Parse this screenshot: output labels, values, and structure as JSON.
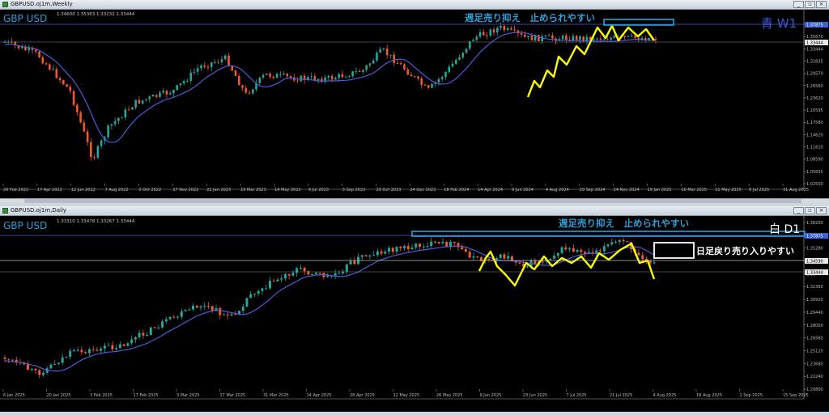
{
  "windows": {
    "weekly": {
      "title": "GBPUSD.oj1m,Weekly",
      "symbol_label": "GBP USD",
      "ohlc": "1.34600 1.35363 1.33232 1.33444",
      "note": "週足売り抑え　止められやすい",
      "tf_label": "青 W1",
      "price_ticks": [
        "1.37875",
        "1.35670",
        "1.33444",
        "1.32835",
        "1.29570",
        "1.26560",
        "1.23620",
        "1.20595",
        "1.17580",
        "1.14620",
        "1.11610",
        "1.08590",
        "1.05655",
        "1.02550"
      ],
      "date_ticks": [
        "20 Feb 2022",
        "17 Apr 2022",
        "12 Jun 2022",
        "7 Aug 2022",
        "2 Oct 2022",
        "27 Nov 2022",
        "22 Jan 2023",
        "19 Mar 2023",
        "14 May 2023",
        "9 Jul 2023",
        "3 Sep 2023",
        "29 Oct 2023",
        "24 Dec 2023",
        "18 Feb 2024",
        "14 Apr 2024",
        "9 Jun 2024",
        "4 Aug 2024",
        "29 Sep 2024",
        "24 Nov 2024",
        "19 Jan 2025",
        "16 Mar 2025",
        "11 May 2025",
        "6 Jul 2025",
        "31 Aug 2025"
      ]
    },
    "daily": {
      "title": "GBPUSD.oj1m,Daily",
      "symbol_label": "GBP USD",
      "ohlc": "1.33310 1.33478 1.33267 1.33444",
      "note": "週足売り抑え　止められやすい",
      "tf_label": "白 D1",
      "note2": "日足戻り売り入りやすい",
      "price_ticks": [
        "1.38200",
        "1.37875",
        "1.35280",
        "1.34590",
        "1.33444",
        "1.32360",
        "1.30920",
        "1.29440",
        "1.28000",
        "1.26560",
        "1.25120",
        "1.23680",
        "1.22240",
        "1.20800"
      ],
      "date_ticks": [
        "6 Jan 2025",
        "20 Jan 2025",
        "3 Feb 2025",
        "17 Feb 2025",
        "3 Mar 2025",
        "17 Mar 2025",
        "31 Mar 2025",
        "14 Apr 2025",
        "28 Apr 2025",
        "12 May 2025",
        "26 May 2025",
        "9 Jun 2025",
        "23 Jun 2025",
        "7 Jul 2025",
        "21 Jul 2025",
        "4 Aug 2025",
        "18 Aug 2025",
        "1 Sep 2025",
        "15 Sep 2025"
      ]
    }
  },
  "colors": {
    "bull": "#26a69a",
    "bear": "#ef5a28",
    "ma": "#4a5cdc",
    "zigzag": "#ffff00",
    "accent": "#2a9fd8"
  },
  "icons": [
    "chart-window-icon",
    "minimize-icon",
    "restore-icon",
    "close-icon"
  ]
}
